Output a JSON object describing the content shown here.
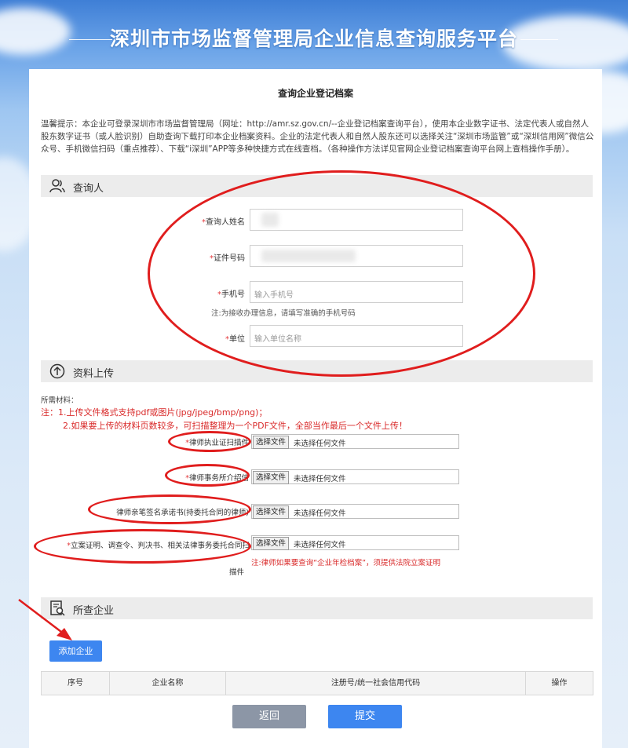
{
  "banner": {
    "title": "深圳市市场监督管理局企业信息查询服务平台"
  },
  "page": {
    "title": "查询企业登记档案",
    "notice": "温馨提示：本企业可登录深圳市市场监督管理局（网址：http://amr.sz.gov.cn/--企业登记档案查询平台），使用本企业数字证书、法定代表人或自然人股东数字证书（或人脸识别）自助查询下载打印本企业档案资料。企业的法定代表人和自然人股东还可以选择关注“深圳市场监管”或“深圳信用网”微信公众号、手机微信扫码（重点推荐）、下载“i深圳”APP等多种快捷方式在线查档。（各种操作方法详见官网企业登记档案查询平台网上查档操作手册）。"
  },
  "inquirer": {
    "section_title": "查询人",
    "name_label": "查询人姓名",
    "id_label": "证件号码",
    "phone_label": "手机号",
    "phone_placeholder": "输入手机号",
    "phone_hint": "注:为接收办理信息，请填写准确的手机号码",
    "unit_label": "单位",
    "unit_placeholder": "输入单位名称"
  },
  "upload": {
    "section_title": "资料上传",
    "materials_label": "所需材料：",
    "note1": "注：1.上传文件格式支持pdf或图片(jpg/jpeg/bmp/png)；",
    "note2": "2.如果要上传的材料页数较多，可扫描整理为一个PDF文件，全部当作最后一个文件上传！",
    "choose_button": "选择文件",
    "no_file": "未选择任何文件",
    "items": [
      {
        "label": "律师执业证扫描件",
        "required": true
      },
      {
        "label": "律师事务所介绍信",
        "required": true
      },
      {
        "label": "律师亲笔签名承诺书(持委托合同的律师)",
        "required": false
      },
      {
        "label": "立案证明、调查令、判决书、相关法律事务委托合同扫描件",
        "required": true
      }
    ],
    "item4_label_line1": "立案证明、调查令、判决书、相关法律事务委托合同扫",
    "item4_label_line2": "描件",
    "item4_note": "注:律师如果要查询“企业年检档案”，须提供法院立案证明"
  },
  "company": {
    "section_title": "所查企业",
    "add_button": "添加企业",
    "columns": [
      "序号",
      "企业名称",
      "注册号/统一社会信用代码",
      "操作"
    ]
  },
  "actions": {
    "back": "返回",
    "submit": "提交"
  },
  "colors": {
    "accent": "#3d86f0",
    "annotation": "#e01d1d",
    "required_star": "#e4393c"
  }
}
